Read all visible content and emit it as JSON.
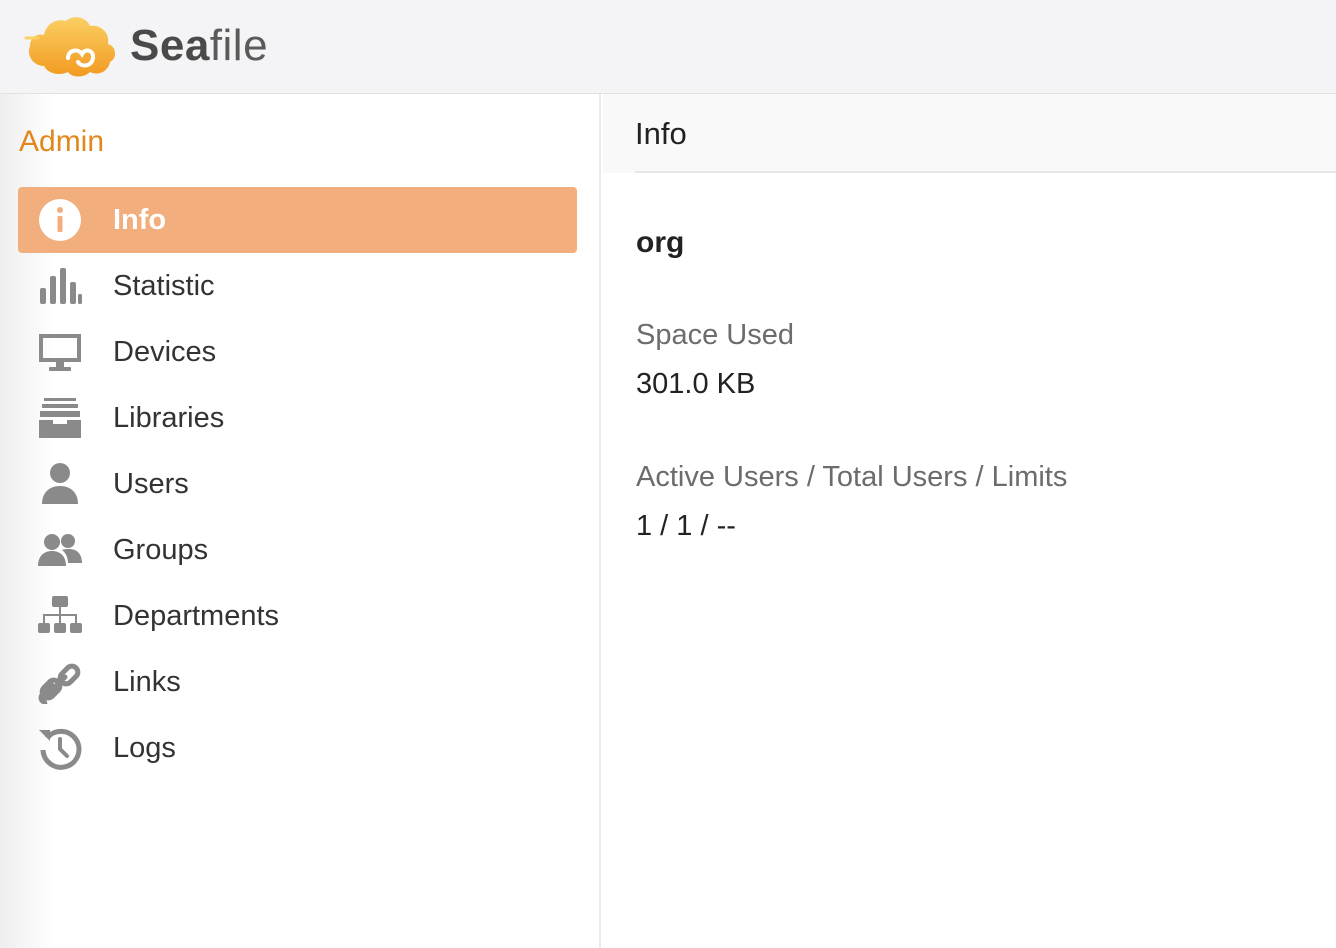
{
  "brand": {
    "name_bold": "Sea",
    "name_rest": "file",
    "logo_icon": "seafile-cloud-logo",
    "accent_color": "#e2871b",
    "active_bg_color": "#f3ae7d"
  },
  "sidebar": {
    "heading": "Admin",
    "items": [
      {
        "label": "Info",
        "icon": "info-icon",
        "active": true
      },
      {
        "label": "Statistic",
        "icon": "bar-chart-icon",
        "active": false
      },
      {
        "label": "Devices",
        "icon": "monitor-icon",
        "active": false
      },
      {
        "label": "Libraries",
        "icon": "archive-icon",
        "active": false
      },
      {
        "label": "Users",
        "icon": "user-icon",
        "active": false
      },
      {
        "label": "Groups",
        "icon": "group-icon",
        "active": false
      },
      {
        "label": "Departments",
        "icon": "org-chart-icon",
        "active": false
      },
      {
        "label": "Links",
        "icon": "link-icon",
        "active": false
      },
      {
        "label": "Logs",
        "icon": "history-icon",
        "active": false
      }
    ]
  },
  "main": {
    "title": "Info",
    "org_name": "org",
    "space_used_label": "Space Used",
    "space_used_value": "301.0 KB",
    "users_label": "Active Users / Total Users / Limits",
    "users_value": "1 / 1 / --"
  }
}
